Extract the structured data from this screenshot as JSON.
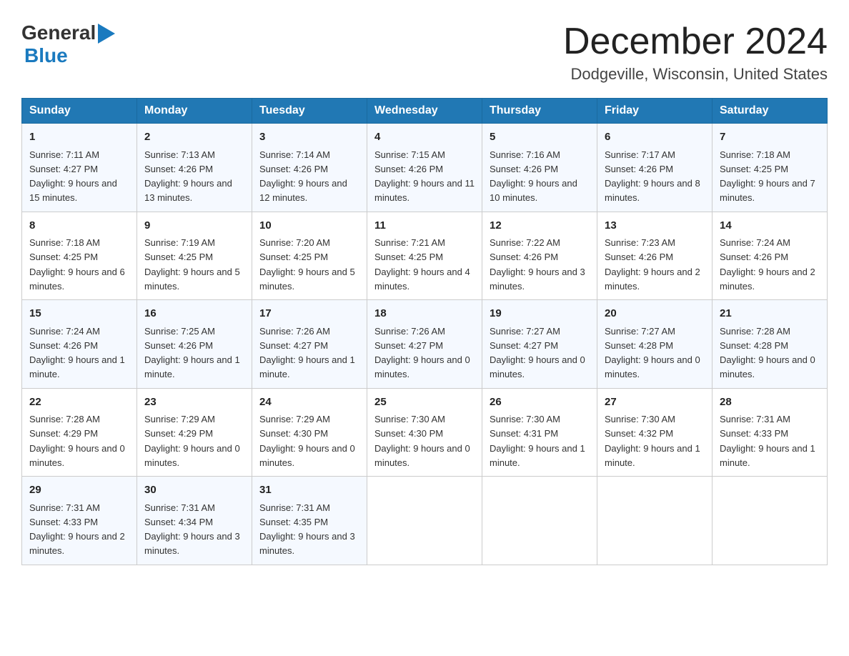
{
  "logo": {
    "text_general": "General",
    "text_blue": "Blue"
  },
  "header": {
    "month_title": "December 2024",
    "location": "Dodgeville, Wisconsin, United States"
  },
  "days_of_week": [
    "Sunday",
    "Monday",
    "Tuesday",
    "Wednesday",
    "Thursday",
    "Friday",
    "Saturday"
  ],
  "weeks": [
    [
      {
        "day": "1",
        "sunrise": "7:11 AM",
        "sunset": "4:27 PM",
        "daylight": "9 hours and 15 minutes."
      },
      {
        "day": "2",
        "sunrise": "7:13 AM",
        "sunset": "4:26 PM",
        "daylight": "9 hours and 13 minutes."
      },
      {
        "day": "3",
        "sunrise": "7:14 AM",
        "sunset": "4:26 PM",
        "daylight": "9 hours and 12 minutes."
      },
      {
        "day": "4",
        "sunrise": "7:15 AM",
        "sunset": "4:26 PM",
        "daylight": "9 hours and 11 minutes."
      },
      {
        "day": "5",
        "sunrise": "7:16 AM",
        "sunset": "4:26 PM",
        "daylight": "9 hours and 10 minutes."
      },
      {
        "day": "6",
        "sunrise": "7:17 AM",
        "sunset": "4:26 PM",
        "daylight": "9 hours and 8 minutes."
      },
      {
        "day": "7",
        "sunrise": "7:18 AM",
        "sunset": "4:25 PM",
        "daylight": "9 hours and 7 minutes."
      }
    ],
    [
      {
        "day": "8",
        "sunrise": "7:18 AM",
        "sunset": "4:25 PM",
        "daylight": "9 hours and 6 minutes."
      },
      {
        "day": "9",
        "sunrise": "7:19 AM",
        "sunset": "4:25 PM",
        "daylight": "9 hours and 5 minutes."
      },
      {
        "day": "10",
        "sunrise": "7:20 AM",
        "sunset": "4:25 PM",
        "daylight": "9 hours and 5 minutes."
      },
      {
        "day": "11",
        "sunrise": "7:21 AM",
        "sunset": "4:25 PM",
        "daylight": "9 hours and 4 minutes."
      },
      {
        "day": "12",
        "sunrise": "7:22 AM",
        "sunset": "4:26 PM",
        "daylight": "9 hours and 3 minutes."
      },
      {
        "day": "13",
        "sunrise": "7:23 AM",
        "sunset": "4:26 PM",
        "daylight": "9 hours and 2 minutes."
      },
      {
        "day": "14",
        "sunrise": "7:24 AM",
        "sunset": "4:26 PM",
        "daylight": "9 hours and 2 minutes."
      }
    ],
    [
      {
        "day": "15",
        "sunrise": "7:24 AM",
        "sunset": "4:26 PM",
        "daylight": "9 hours and 1 minute."
      },
      {
        "day": "16",
        "sunrise": "7:25 AM",
        "sunset": "4:26 PM",
        "daylight": "9 hours and 1 minute."
      },
      {
        "day": "17",
        "sunrise": "7:26 AM",
        "sunset": "4:27 PM",
        "daylight": "9 hours and 1 minute."
      },
      {
        "day": "18",
        "sunrise": "7:26 AM",
        "sunset": "4:27 PM",
        "daylight": "9 hours and 0 minutes."
      },
      {
        "day": "19",
        "sunrise": "7:27 AM",
        "sunset": "4:27 PM",
        "daylight": "9 hours and 0 minutes."
      },
      {
        "day": "20",
        "sunrise": "7:27 AM",
        "sunset": "4:28 PM",
        "daylight": "9 hours and 0 minutes."
      },
      {
        "day": "21",
        "sunrise": "7:28 AM",
        "sunset": "4:28 PM",
        "daylight": "9 hours and 0 minutes."
      }
    ],
    [
      {
        "day": "22",
        "sunrise": "7:28 AM",
        "sunset": "4:29 PM",
        "daylight": "9 hours and 0 minutes."
      },
      {
        "day": "23",
        "sunrise": "7:29 AM",
        "sunset": "4:29 PM",
        "daylight": "9 hours and 0 minutes."
      },
      {
        "day": "24",
        "sunrise": "7:29 AM",
        "sunset": "4:30 PM",
        "daylight": "9 hours and 0 minutes."
      },
      {
        "day": "25",
        "sunrise": "7:30 AM",
        "sunset": "4:30 PM",
        "daylight": "9 hours and 0 minutes."
      },
      {
        "day": "26",
        "sunrise": "7:30 AM",
        "sunset": "4:31 PM",
        "daylight": "9 hours and 1 minute."
      },
      {
        "day": "27",
        "sunrise": "7:30 AM",
        "sunset": "4:32 PM",
        "daylight": "9 hours and 1 minute."
      },
      {
        "day": "28",
        "sunrise": "7:31 AM",
        "sunset": "4:33 PM",
        "daylight": "9 hours and 1 minute."
      }
    ],
    [
      {
        "day": "29",
        "sunrise": "7:31 AM",
        "sunset": "4:33 PM",
        "daylight": "9 hours and 2 minutes."
      },
      {
        "day": "30",
        "sunrise": "7:31 AM",
        "sunset": "4:34 PM",
        "daylight": "9 hours and 3 minutes."
      },
      {
        "day": "31",
        "sunrise": "7:31 AM",
        "sunset": "4:35 PM",
        "daylight": "9 hours and 3 minutes."
      },
      null,
      null,
      null,
      null
    ]
  ]
}
